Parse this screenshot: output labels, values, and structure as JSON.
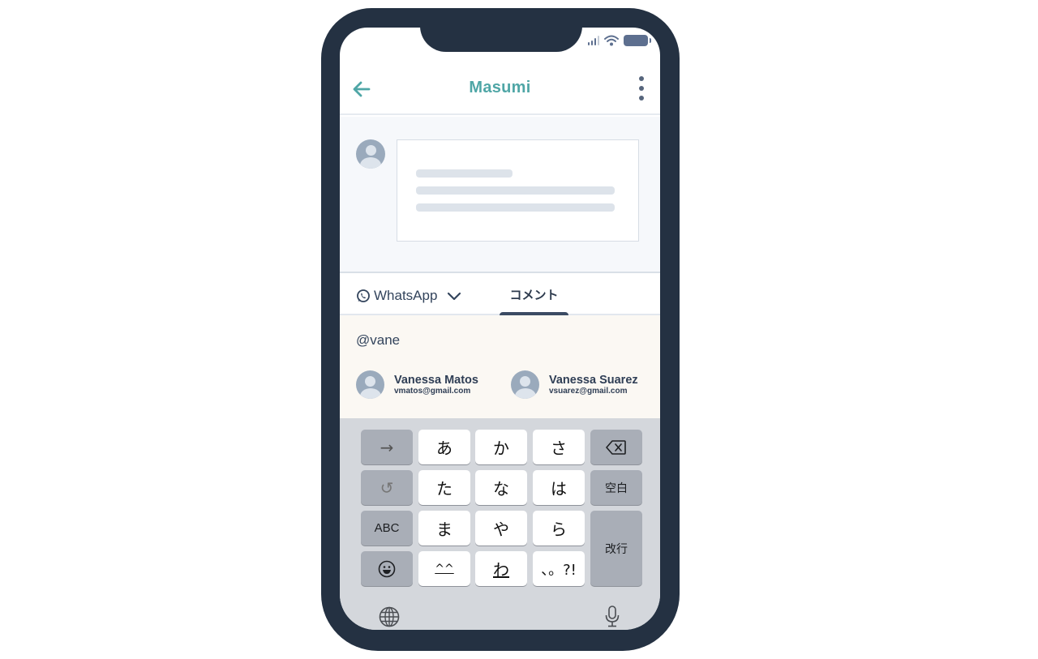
{
  "status_bar": {
    "icons": [
      "cellular-signal-icon",
      "wifi-icon",
      "battery-icon"
    ]
  },
  "header": {
    "title": "Masumi",
    "back_icon": "arrow-left-icon",
    "more_icon": "more-vertical-icon"
  },
  "colors": {
    "accent": "#4fa6a6",
    "frame": "#243142",
    "tab_indicator": "#3b4b63",
    "composer_bg": "#fbf8f3",
    "keyboard_bg": "#d4d7dc"
  },
  "feed": {
    "placeholder_lines": 3
  },
  "tabs": {
    "channel": {
      "icon": "whatsapp-icon",
      "label": "WhatsApp",
      "dropdown_icon": "chevron-down-icon"
    },
    "active_tab": "コメント"
  },
  "composer": {
    "value": "@vane",
    "suggestions": [
      {
        "name": "Vanessa Matos",
        "email": "vmatos@gmail.com"
      },
      {
        "name": "Vanessa Suarez",
        "email": "vsuarez@gmail.com"
      }
    ]
  },
  "keyboard": {
    "rows": [
      [
        "→",
        "あ",
        "か",
        "さ",
        "⌫"
      ],
      [
        "↺",
        "た",
        "な",
        "は",
        "空白"
      ],
      [
        "ABC",
        "ま",
        "や",
        "ら",
        "改行"
      ],
      [
        "☺",
        "^^",
        "わ",
        "、。?!"
      ]
    ],
    "bottom": {
      "globe_icon": "globe-icon",
      "mic_icon": "microphone-icon"
    }
  }
}
